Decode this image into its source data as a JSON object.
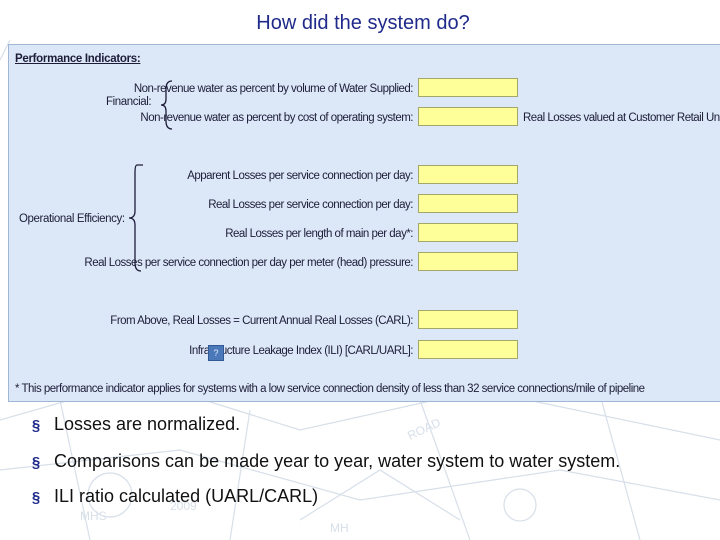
{
  "slide": {
    "title": "How did the system do?"
  },
  "panel": {
    "heading": "Performance Indicators:",
    "groups": {
      "financial": "Financial:",
      "operational": "Operational Efficiency:"
    },
    "rows": [
      {
        "label": "Non-revenue water as percent by volume of Water Supplied:",
        "value": ""
      },
      {
        "label": "Non-revenue water as percent by cost of operating system:",
        "value": "",
        "side_label": "Real Losses valued at Customer Retail Unit Cost"
      },
      {
        "label": "Apparent Losses per service connection per day:",
        "value": ""
      },
      {
        "label": "Real Losses per service connection per day:",
        "value": ""
      },
      {
        "label": "Real Losses per length of main per day*:",
        "value": ""
      },
      {
        "label": "Real Losses per service connection per day per meter (head) pressure:",
        "value": ""
      },
      {
        "label": "From Above, Real Losses = Current Annual Real Losses (CARL):",
        "value": ""
      },
      {
        "label": "Infrastructure Leakage Index (ILI) [CARL/UARL]:",
        "value": ""
      }
    ],
    "help_button": "?",
    "footnote": "* This performance indicator applies for systems with a low service connection density of less than 32 service connections/mile of pipeline"
  },
  "bullets": [
    "Losses are normalized.",
    "Comparisons can be made year to year, water system to water system.",
    "ILI ratio calculated (UARL/CARL)"
  ],
  "colors": {
    "title": "#1f2a8a",
    "panel_bg": "#dce8f7",
    "input_bg": "#ffff99"
  }
}
